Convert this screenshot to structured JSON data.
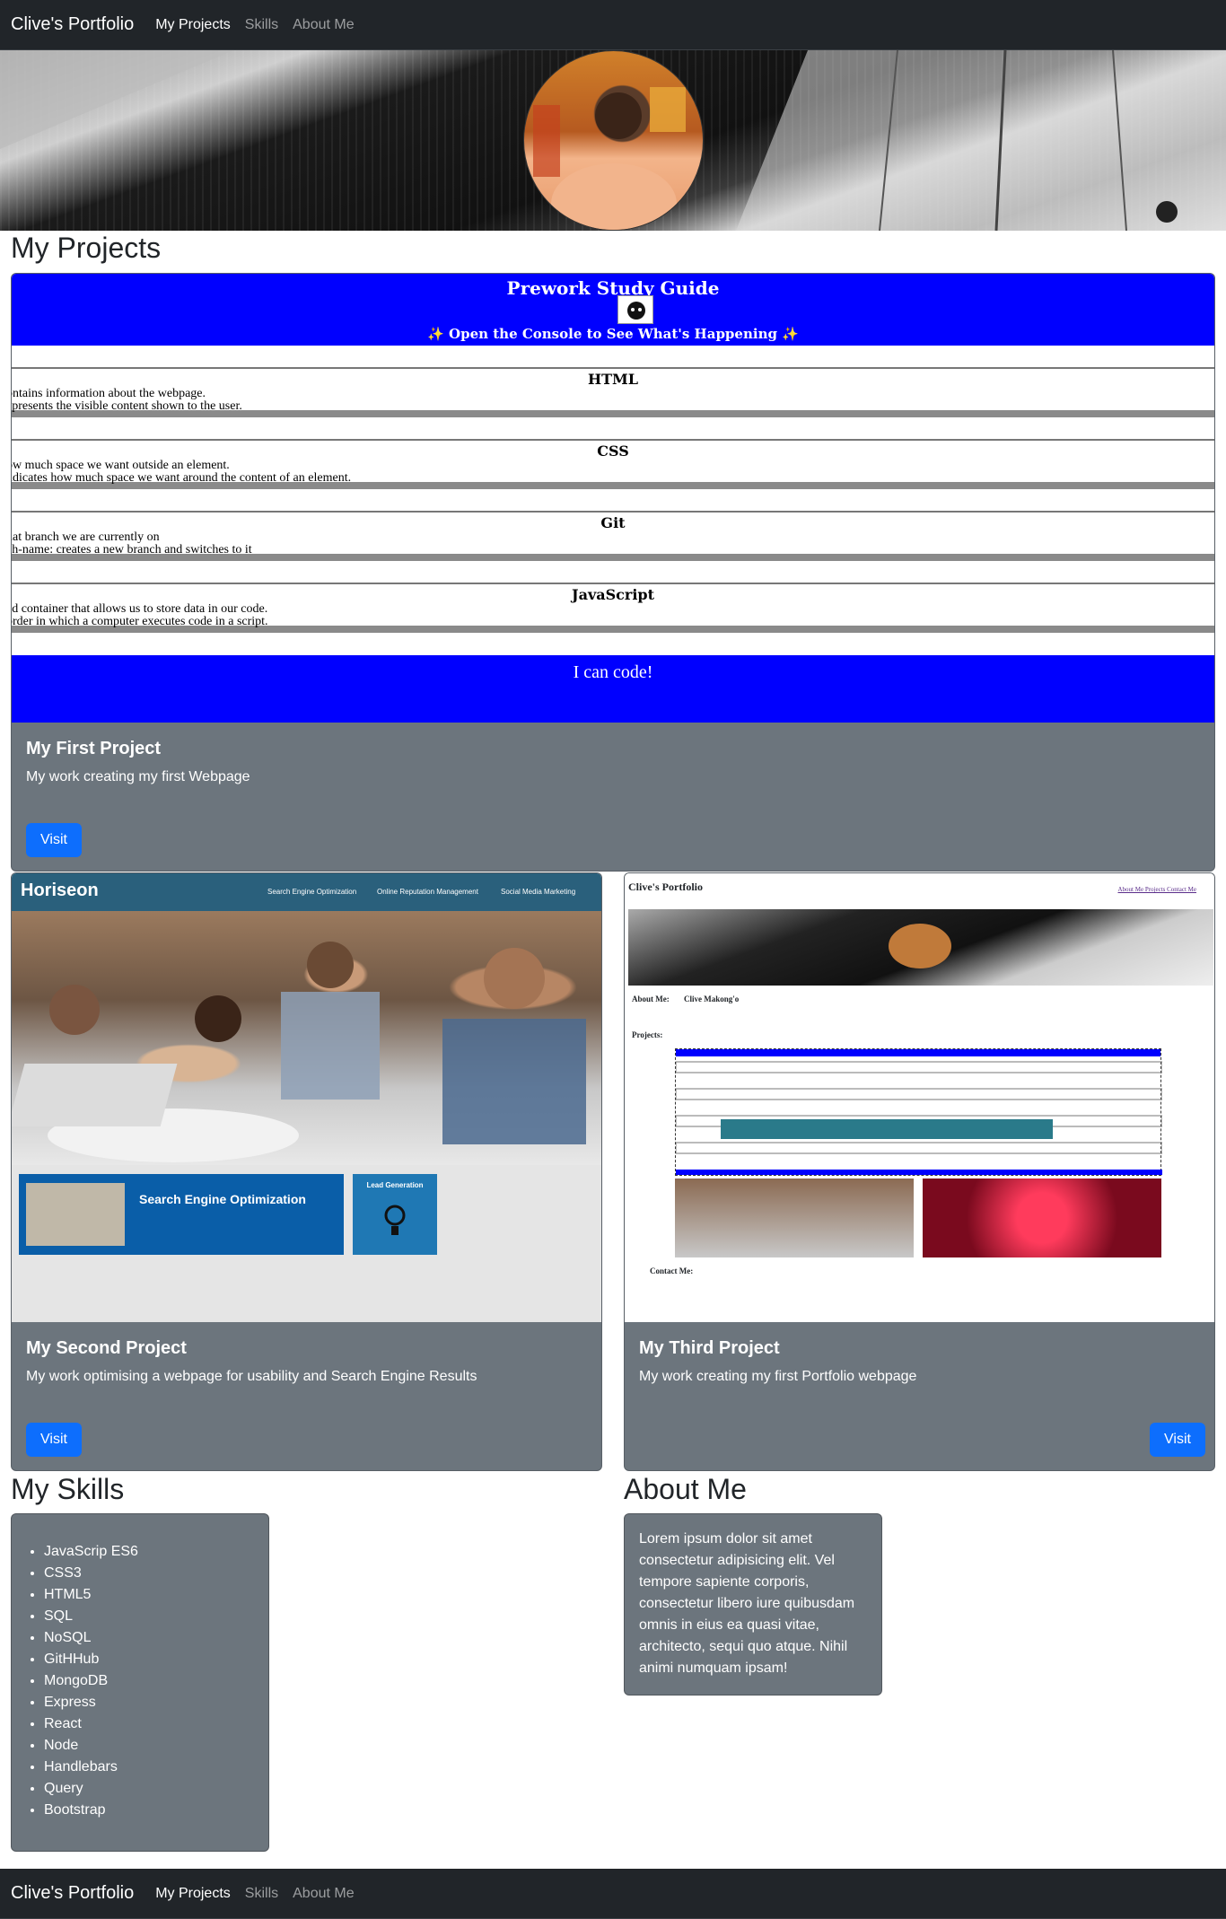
{
  "nav": {
    "brand": "Clive's Portfolio",
    "links": [
      "My Projects",
      "Skills",
      "About Me"
    ]
  },
  "sections": {
    "projects": "My Projects",
    "skills": "My Skills",
    "about": "About Me"
  },
  "projects": [
    {
      "title": "My First Project",
      "text": "My work creating my first Webpage",
      "button": "Visit",
      "preview": {
        "heading": "Prework Study Guide",
        "subheading": "✨ Open the Console to See What's Happening ✨",
        "blocks": [
          {
            "title": "HTML",
            "lines": [
              "ontains information about the webpage.",
              "epresents the visible content shown to the user."
            ]
          },
          {
            "title": "CSS",
            "lines": [
              "ow much space we want outside an element.",
              "ndicates how much space we want around the content of an element."
            ]
          },
          {
            "title": "Git",
            "lines": [
              "hat branch we are currently on",
              "ch-name: creates a new branch and switches to it"
            ]
          },
          {
            "title": "JavaScript",
            "lines": [
              "ed container that allows us to store data in our code.",
              "order in which a computer executes code in a script."
            ]
          }
        ],
        "footer": "I can code!"
      }
    },
    {
      "title": "My Second Project",
      "text": "My work optimising a webpage for usability and Search Engine Results",
      "button": "Visit",
      "preview": {
        "logo": "Horiseon",
        "nav": [
          "Search Engine Optimization",
          "Online Reputation Management",
          "Social Media Marketing"
        ],
        "feature_title": "Search Engine Optimization",
        "sidebar_title": "Lead Generation"
      }
    },
    {
      "title": "My Third Project",
      "text": "My work creating my first Portfolio webpage",
      "button": "Visit",
      "preview": {
        "title": "Clive's Portfolio",
        "links": "About Me   Projects   Contact Me",
        "about_label": "About Me:",
        "name": "Clive Makong'o",
        "projects_label": "Projects:",
        "contact_label": "Contact Me:"
      }
    }
  ],
  "skills": [
    "JavaScrip ES6",
    "CSS3",
    "HTML5",
    "SQL",
    "NoSQL",
    "GitHHub",
    "MongoDB",
    "Express",
    "React",
    "Node",
    "Handlebars",
    "Query",
    "Bootstrap"
  ],
  "about": "Lorem ipsum dolor sit amet consectetur adipisicing elit. Vel tempore sapiente corporis, consectetur libero iure quibusdam omnis in eius ea quasi vitae, architecto, sequi quo atque. Nihil animi numquam ipsam!",
  "colors": {
    "navbar": "#212529",
    "card": "#6c757d",
    "button": "#0d6efd",
    "study_guide_blue": "#0000ff"
  }
}
